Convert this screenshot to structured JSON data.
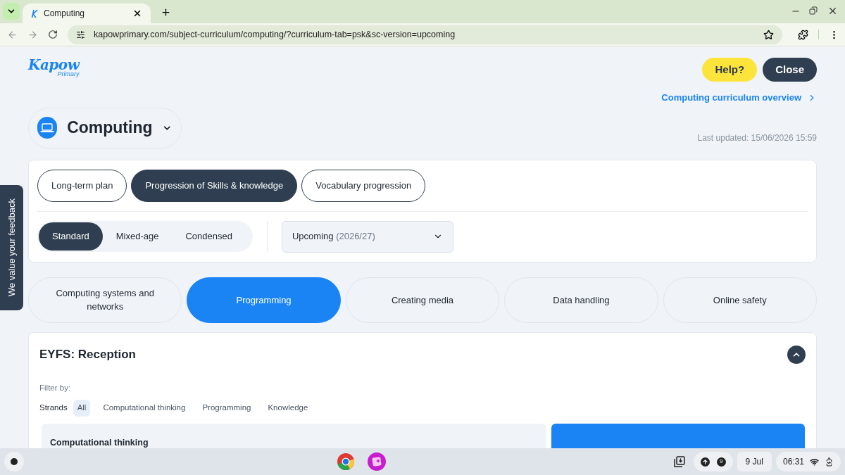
{
  "browser": {
    "tab_title": "Computing",
    "url": "kapowprimary.com/subject-curriculum/computing/?curriculum-tab=psk&sc-version=upcoming"
  },
  "logo": {
    "title": "Kapow",
    "subtitle": "Primary"
  },
  "header_buttons": [
    {
      "label": "Help?",
      "kind": "help"
    },
    {
      "label": "Close",
      "kind": "close"
    }
  ],
  "overview_link": "Computing curriculum overview",
  "subject": "Computing",
  "last_updated": "Last updated: 15/06/2026 15:59",
  "curriculum_tabs": [
    {
      "label": "Long-term plan",
      "selected": false
    },
    {
      "label": "Progression of Skills & knowledge",
      "selected": true
    },
    {
      "label": "Vocabulary progression",
      "selected": false
    }
  ],
  "layouts": [
    {
      "label": "Standard",
      "selected": true
    },
    {
      "label": "Mixed-age",
      "selected": false
    },
    {
      "label": "Condensed",
      "selected": false
    }
  ],
  "version": {
    "label": "Upcoming",
    "detail": "(2026/27)"
  },
  "strands": [
    {
      "label": "Computing systems and networks",
      "selected": false
    },
    {
      "label": "Programming",
      "selected": true
    },
    {
      "label": "Creating media",
      "selected": false
    },
    {
      "label": "Data handling",
      "selected": false
    },
    {
      "label": "Online safety",
      "selected": false
    }
  ],
  "section": {
    "title": "EYFS: Reception",
    "expanded": true,
    "filter_label": "Filter by:",
    "strands_label": "Strands",
    "filters": [
      {
        "label": "All",
        "selected": true
      },
      {
        "label": "Computational thinking",
        "selected": false
      },
      {
        "label": "Programming",
        "selected": false
      },
      {
        "label": "Knowledge",
        "selected": false
      }
    ],
    "cards": [
      {
        "kind": "plain",
        "title": "Computational thinking"
      },
      {
        "kind": "highlight"
      }
    ]
  },
  "feedback_tab": "We value your feedback",
  "taskbar": {
    "notification_count": "9",
    "date": "9 Jul",
    "time": "06:31"
  }
}
